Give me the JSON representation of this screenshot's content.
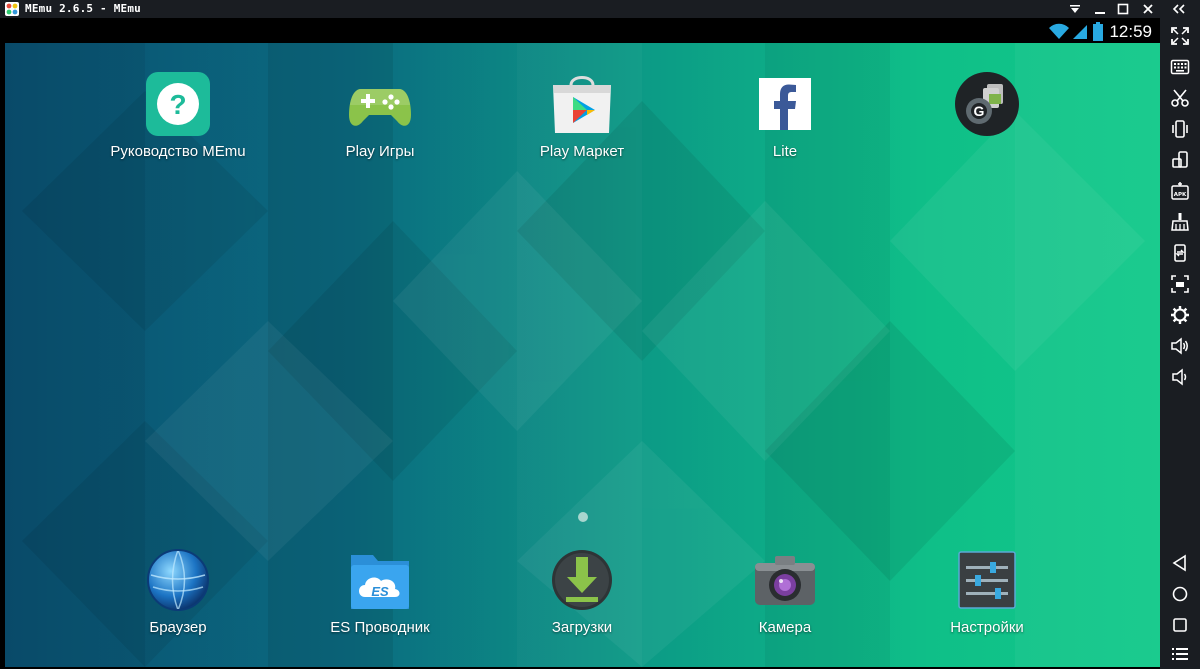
{
  "window": {
    "title": "MEmu 2.6.5 - MEmu",
    "controls": [
      "dropdown-icon",
      "minimize-icon",
      "maximize-icon",
      "close-icon"
    ]
  },
  "collapse_icon": "double-chevron-left-icon",
  "statusbar": {
    "time": "12:59",
    "icons": [
      "wifi-icon",
      "signal-icon",
      "battery-icon"
    ]
  },
  "apps_top": [
    {
      "label": "Руководство MEmu",
      "icon": "memu-guide-icon"
    },
    {
      "label": "Play Игры",
      "icon": "play-games-icon"
    },
    {
      "label": "Play Маркет",
      "icon": "play-store-icon"
    },
    {
      "label": "Lite",
      "icon": "facebook-lite-icon"
    },
    {
      "label": "",
      "icon": "google-settings-icon"
    }
  ],
  "apps_dock": [
    {
      "label": "Браузер",
      "icon": "browser-icon"
    },
    {
      "label": "ES Проводник",
      "icon": "es-explorer-icon"
    },
    {
      "label": "Загрузки",
      "icon": "downloads-icon"
    },
    {
      "label": "Камера",
      "icon": "camera-icon"
    },
    {
      "label": "Настройки",
      "icon": "settings-icon"
    }
  ],
  "sidebar_tools": [
    "fullscreen-icon",
    "keyboard-icon",
    "scissors-icon",
    "shake-icon",
    "rotate-icon",
    "install-apk-icon",
    "clean-icon",
    "sync-icon",
    "screenshot-icon",
    "gear-icon",
    "volume-up-icon",
    "volume-down-icon"
  ],
  "sidebar_nav": [
    "back-icon",
    "home-icon",
    "recents-icon",
    "menu-icon"
  ],
  "colors": {
    "wallpaper_dark": "#0a5272",
    "wallpaper_light": "#10c889",
    "frame": "#1a1d22"
  }
}
